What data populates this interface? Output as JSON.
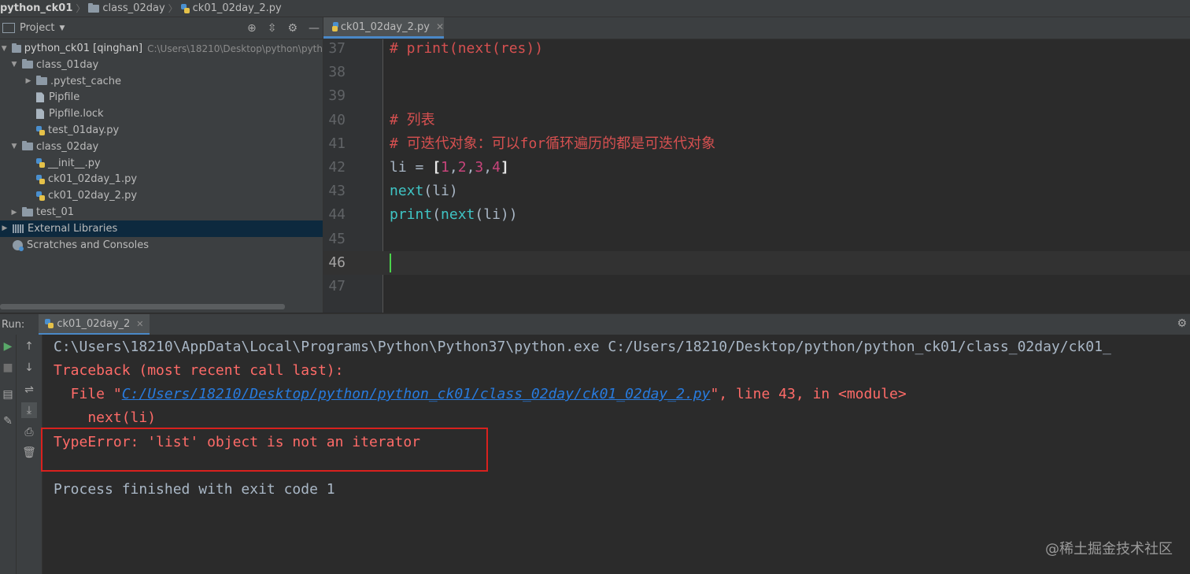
{
  "breadcrumb": {
    "project": "python_ck01",
    "folder": "class_02day",
    "file": "ck01_02day_2.py"
  },
  "project_panel": {
    "title": "Project",
    "tree": [
      {
        "label": "python_ck01 [qinghan]",
        "hint": "C:\\Users\\18210\\Desktop\\python\\pyth",
        "type": "folder",
        "arrow": "▼",
        "indent": 0
      },
      {
        "label": "class_01day",
        "type": "folder",
        "arrow": "▼",
        "indent": 1
      },
      {
        "label": ".pytest_cache",
        "type": "folder",
        "arrow": "▶",
        "indent": 2
      },
      {
        "label": "Pipfile",
        "type": "file",
        "arrow": "",
        "indent": 2
      },
      {
        "label": "Pipfile.lock",
        "type": "file",
        "arrow": "",
        "indent": 2
      },
      {
        "label": "test_01day.py",
        "type": "py",
        "arrow": "",
        "indent": 2
      },
      {
        "label": "class_02day",
        "type": "folder",
        "arrow": "▼",
        "indent": 1
      },
      {
        "label": "__init__.py",
        "type": "py",
        "arrow": "",
        "indent": 2
      },
      {
        "label": "ck01_02day_1.py",
        "type": "py",
        "arrow": "",
        "indent": 2
      },
      {
        "label": "ck01_02day_2.py",
        "type": "py",
        "arrow": "",
        "indent": 2
      },
      {
        "label": "test_01",
        "type": "folder",
        "arrow": "▶",
        "indent": 1
      },
      {
        "label": "External Libraries",
        "type": "lib",
        "arrow": "▶",
        "indent": 0,
        "selected": true
      },
      {
        "label": "Scratches and Consoles",
        "type": "scratch",
        "arrow": "",
        "indent": 0
      }
    ]
  },
  "editor": {
    "tab_label": "ck01_02day_2.py",
    "lines": [
      {
        "num": "37",
        "text": "# print(next(res))"
      },
      {
        "num": "38",
        "text": ""
      },
      {
        "num": "39",
        "text": ""
      },
      {
        "num": "40",
        "text": "# 列表"
      },
      {
        "num": "41",
        "text": "# 可迭代对象：可以for循环遍历的都是可迭代对象"
      },
      {
        "num": "42",
        "text": "li = [1,2,3,4]"
      },
      {
        "num": "43",
        "text": "next(li)"
      },
      {
        "num": "44",
        "text": "print(next(li))"
      },
      {
        "num": "45",
        "text": ""
      },
      {
        "num": "46",
        "text": ""
      },
      {
        "num": "47",
        "text": ""
      }
    ],
    "current_line": "46"
  },
  "run_panel": {
    "label": "Run:",
    "tab_label": "ck01_02day_2",
    "console": {
      "cmd": "C:\\Users\\18210\\AppData\\Local\\Programs\\Python\\Python37\\python.exe C:/Users/18210/Desktop/python/python_ck01/class_02day/ck01_",
      "traceback": "Traceback (most recent call last):",
      "file_prefix": "  File \"",
      "file_link": "C:/Users/18210/Desktop/python/python_ck01/class_02day/ck01_02day_2.py",
      "file_suffix": "\", line 43, in <module>",
      "code": "    next(li)",
      "error": "TypeError: 'list' object is not an iterator",
      "finished": "Process finished with exit code 1"
    }
  },
  "watermark": "@稀土掘金技术社区",
  "colors": {
    "accent": "#4a88c7",
    "error_box": "#d9211e",
    "error_text": "#ff6b68",
    "caret": "#4bd34b"
  }
}
